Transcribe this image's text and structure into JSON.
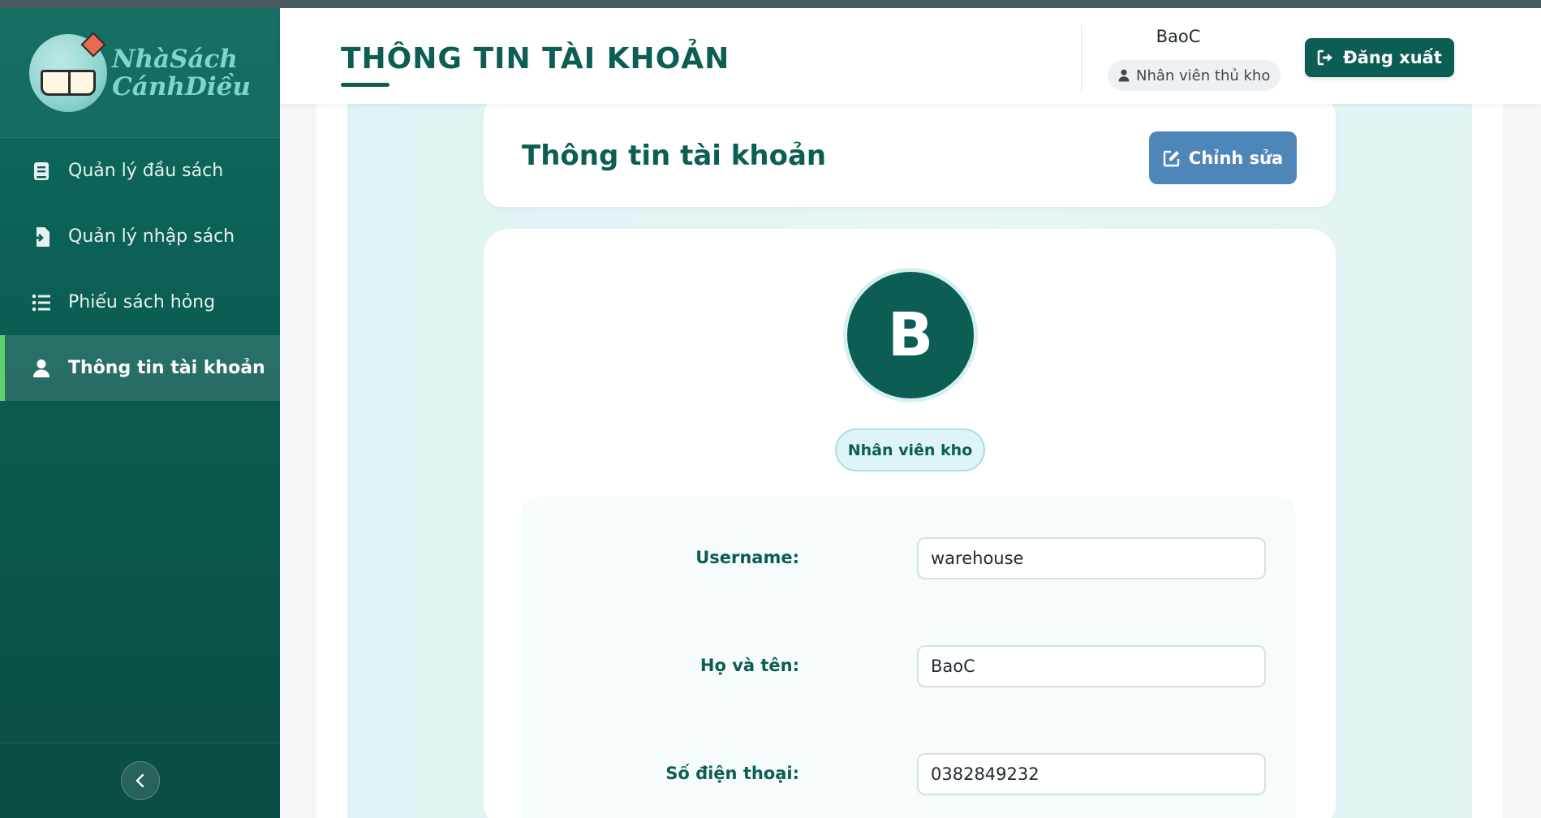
{
  "sidebar": {
    "logo": {
      "line1": "NhàSách",
      "line2": "CánhDiều"
    },
    "items": [
      {
        "label": "Quản lý đầu sách",
        "icon": "book-icon"
      },
      {
        "label": "Quản lý nhập sách",
        "icon": "file-import-icon"
      },
      {
        "label": "Phiếu sách hỏng",
        "icon": "list-icon"
      },
      {
        "label": "Thông tin tài khoản",
        "icon": "user-icon",
        "active": true
      }
    ],
    "collapse_icon": "chevron-left-icon"
  },
  "header": {
    "title": "THÔNG TIN TÀI KHOẢN",
    "user_name": "BaoC",
    "user_role": "Nhân viên thủ kho",
    "logout_label": "Đăng xuất"
  },
  "card": {
    "title": "Thông tin tài khoản",
    "edit_label": "Chỉnh sửa"
  },
  "profile": {
    "avatar_initial": "B",
    "role_badge": "Nhân viên kho",
    "fields": [
      {
        "label": "Username:",
        "value": "warehouse"
      },
      {
        "label": "Họ và tên:",
        "value": "BaoC"
      },
      {
        "label": "Số điện thoại:",
        "value": "0382849232"
      }
    ]
  },
  "colors": {
    "primary": "#0c5e54",
    "accent": "#5fd06a",
    "edit_button": "#4f86b9"
  }
}
